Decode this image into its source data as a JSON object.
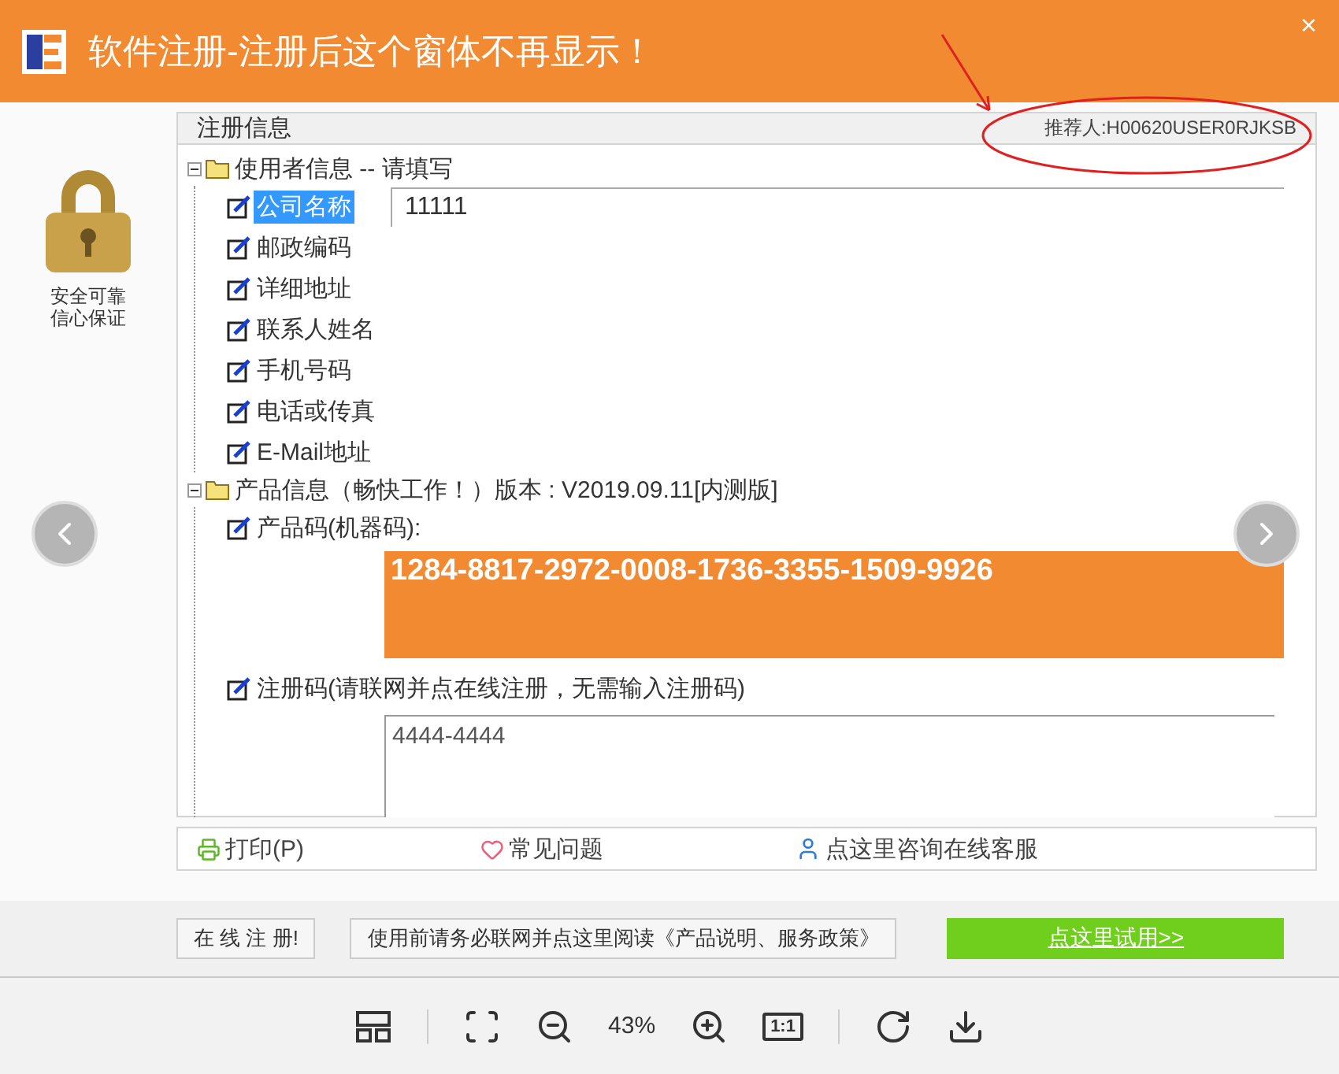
{
  "window": {
    "title": "软件注册-注册后这个窗体不再显示！",
    "close": "×"
  },
  "side": {
    "caption_lines": [
      "安全可靠",
      "信心保证"
    ]
  },
  "panel": {
    "title": "注册信息",
    "referrer": "推荐人:H00620USER0RJKSB"
  },
  "tree": [
    {
      "label": "使用者信息 -- 请填写",
      "expanded": true,
      "children": [
        {
          "kind": "field",
          "label": "公司名称",
          "selected": true,
          "value": "11111"
        },
        {
          "kind": "field",
          "label": "邮政编码",
          "selected": false
        },
        {
          "kind": "field",
          "label": "详细地址",
          "selected": false
        },
        {
          "kind": "field",
          "label": "联系人姓名",
          "selected": false
        },
        {
          "kind": "field",
          "label": "手机号码",
          "selected": false
        },
        {
          "kind": "field",
          "label": "电话或传真",
          "selected": false
        },
        {
          "kind": "field",
          "label": "E-Mail地址",
          "selected": false
        }
      ]
    },
    {
      "label": "产品信息（畅快工作！）版本 : V2019.09.11[内测版]",
      "expanded": true,
      "children": [
        {
          "kind": "code",
          "label": "产品码(机器码):",
          "selected": false,
          "value": "1284-8817-2972-0008-1736-3355-1509-9926"
        },
        {
          "kind": "area",
          "label": "注册码(请联网并点在线注册，无需输入注册码)",
          "selected": false,
          "value": "4444-4444"
        }
      ]
    }
  ],
  "links": [
    {
      "kind": "print",
      "label": "打印(P)"
    },
    {
      "kind": "faq",
      "label": "常见问题"
    },
    {
      "kind": "support",
      "label": "点这里咨询在线客服"
    }
  ],
  "buttons": [
    {
      "kind": "plain",
      "label": "在 线 注 册!"
    },
    {
      "kind": "plain",
      "label": "使用前请务必联网并点这里阅读《产品说明、服务政策》"
    },
    {
      "kind": "primary",
      "label": "点这里试用>>"
    }
  ],
  "viewer": {
    "zoom": "43%",
    "actual_size": "1:1"
  }
}
